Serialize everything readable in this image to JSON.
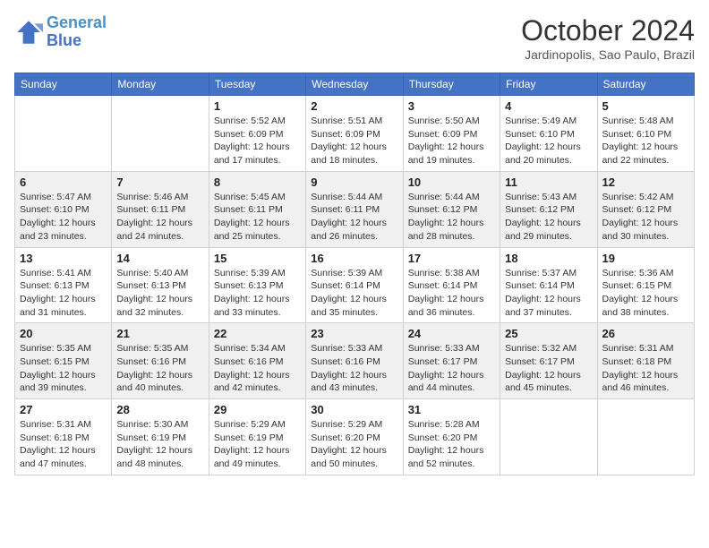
{
  "header": {
    "logo_line1": "General",
    "logo_line2": "Blue",
    "month_title": "October 2024",
    "location": "Jardinopolis, Sao Paulo, Brazil"
  },
  "weekdays": [
    "Sunday",
    "Monday",
    "Tuesday",
    "Wednesday",
    "Thursday",
    "Friday",
    "Saturday"
  ],
  "weeks": [
    [
      {
        "day": "",
        "sunrise": "",
        "sunset": "",
        "daylight": ""
      },
      {
        "day": "",
        "sunrise": "",
        "sunset": "",
        "daylight": ""
      },
      {
        "day": "1",
        "sunrise": "Sunrise: 5:52 AM",
        "sunset": "Sunset: 6:09 PM",
        "daylight": "Daylight: 12 hours and 17 minutes."
      },
      {
        "day": "2",
        "sunrise": "Sunrise: 5:51 AM",
        "sunset": "Sunset: 6:09 PM",
        "daylight": "Daylight: 12 hours and 18 minutes."
      },
      {
        "day": "3",
        "sunrise": "Sunrise: 5:50 AM",
        "sunset": "Sunset: 6:09 PM",
        "daylight": "Daylight: 12 hours and 19 minutes."
      },
      {
        "day": "4",
        "sunrise": "Sunrise: 5:49 AM",
        "sunset": "Sunset: 6:10 PM",
        "daylight": "Daylight: 12 hours and 20 minutes."
      },
      {
        "day": "5",
        "sunrise": "Sunrise: 5:48 AM",
        "sunset": "Sunset: 6:10 PM",
        "daylight": "Daylight: 12 hours and 22 minutes."
      }
    ],
    [
      {
        "day": "6",
        "sunrise": "Sunrise: 5:47 AM",
        "sunset": "Sunset: 6:10 PM",
        "daylight": "Daylight: 12 hours and 23 minutes."
      },
      {
        "day": "7",
        "sunrise": "Sunrise: 5:46 AM",
        "sunset": "Sunset: 6:11 PM",
        "daylight": "Daylight: 12 hours and 24 minutes."
      },
      {
        "day": "8",
        "sunrise": "Sunrise: 5:45 AM",
        "sunset": "Sunset: 6:11 PM",
        "daylight": "Daylight: 12 hours and 25 minutes."
      },
      {
        "day": "9",
        "sunrise": "Sunrise: 5:44 AM",
        "sunset": "Sunset: 6:11 PM",
        "daylight": "Daylight: 12 hours and 26 minutes."
      },
      {
        "day": "10",
        "sunrise": "Sunrise: 5:44 AM",
        "sunset": "Sunset: 6:12 PM",
        "daylight": "Daylight: 12 hours and 28 minutes."
      },
      {
        "day": "11",
        "sunrise": "Sunrise: 5:43 AM",
        "sunset": "Sunset: 6:12 PM",
        "daylight": "Daylight: 12 hours and 29 minutes."
      },
      {
        "day": "12",
        "sunrise": "Sunrise: 5:42 AM",
        "sunset": "Sunset: 6:12 PM",
        "daylight": "Daylight: 12 hours and 30 minutes."
      }
    ],
    [
      {
        "day": "13",
        "sunrise": "Sunrise: 5:41 AM",
        "sunset": "Sunset: 6:13 PM",
        "daylight": "Daylight: 12 hours and 31 minutes."
      },
      {
        "day": "14",
        "sunrise": "Sunrise: 5:40 AM",
        "sunset": "Sunset: 6:13 PM",
        "daylight": "Daylight: 12 hours and 32 minutes."
      },
      {
        "day": "15",
        "sunrise": "Sunrise: 5:39 AM",
        "sunset": "Sunset: 6:13 PM",
        "daylight": "Daylight: 12 hours and 33 minutes."
      },
      {
        "day": "16",
        "sunrise": "Sunrise: 5:39 AM",
        "sunset": "Sunset: 6:14 PM",
        "daylight": "Daylight: 12 hours and 35 minutes."
      },
      {
        "day": "17",
        "sunrise": "Sunrise: 5:38 AM",
        "sunset": "Sunset: 6:14 PM",
        "daylight": "Daylight: 12 hours and 36 minutes."
      },
      {
        "day": "18",
        "sunrise": "Sunrise: 5:37 AM",
        "sunset": "Sunset: 6:14 PM",
        "daylight": "Daylight: 12 hours and 37 minutes."
      },
      {
        "day": "19",
        "sunrise": "Sunrise: 5:36 AM",
        "sunset": "Sunset: 6:15 PM",
        "daylight": "Daylight: 12 hours and 38 minutes."
      }
    ],
    [
      {
        "day": "20",
        "sunrise": "Sunrise: 5:35 AM",
        "sunset": "Sunset: 6:15 PM",
        "daylight": "Daylight: 12 hours and 39 minutes."
      },
      {
        "day": "21",
        "sunrise": "Sunrise: 5:35 AM",
        "sunset": "Sunset: 6:16 PM",
        "daylight": "Daylight: 12 hours and 40 minutes."
      },
      {
        "day": "22",
        "sunrise": "Sunrise: 5:34 AM",
        "sunset": "Sunset: 6:16 PM",
        "daylight": "Daylight: 12 hours and 42 minutes."
      },
      {
        "day": "23",
        "sunrise": "Sunrise: 5:33 AM",
        "sunset": "Sunset: 6:16 PM",
        "daylight": "Daylight: 12 hours and 43 minutes."
      },
      {
        "day": "24",
        "sunrise": "Sunrise: 5:33 AM",
        "sunset": "Sunset: 6:17 PM",
        "daylight": "Daylight: 12 hours and 44 minutes."
      },
      {
        "day": "25",
        "sunrise": "Sunrise: 5:32 AM",
        "sunset": "Sunset: 6:17 PM",
        "daylight": "Daylight: 12 hours and 45 minutes."
      },
      {
        "day": "26",
        "sunrise": "Sunrise: 5:31 AM",
        "sunset": "Sunset: 6:18 PM",
        "daylight": "Daylight: 12 hours and 46 minutes."
      }
    ],
    [
      {
        "day": "27",
        "sunrise": "Sunrise: 5:31 AM",
        "sunset": "Sunset: 6:18 PM",
        "daylight": "Daylight: 12 hours and 47 minutes."
      },
      {
        "day": "28",
        "sunrise": "Sunrise: 5:30 AM",
        "sunset": "Sunset: 6:19 PM",
        "daylight": "Daylight: 12 hours and 48 minutes."
      },
      {
        "day": "29",
        "sunrise": "Sunrise: 5:29 AM",
        "sunset": "Sunset: 6:19 PM",
        "daylight": "Daylight: 12 hours and 49 minutes."
      },
      {
        "day": "30",
        "sunrise": "Sunrise: 5:29 AM",
        "sunset": "Sunset: 6:20 PM",
        "daylight": "Daylight: 12 hours and 50 minutes."
      },
      {
        "day": "31",
        "sunrise": "Sunrise: 5:28 AM",
        "sunset": "Sunset: 6:20 PM",
        "daylight": "Daylight: 12 hours and 52 minutes."
      },
      {
        "day": "",
        "sunrise": "",
        "sunset": "",
        "daylight": ""
      },
      {
        "day": "",
        "sunrise": "",
        "sunset": "",
        "daylight": ""
      }
    ]
  ]
}
